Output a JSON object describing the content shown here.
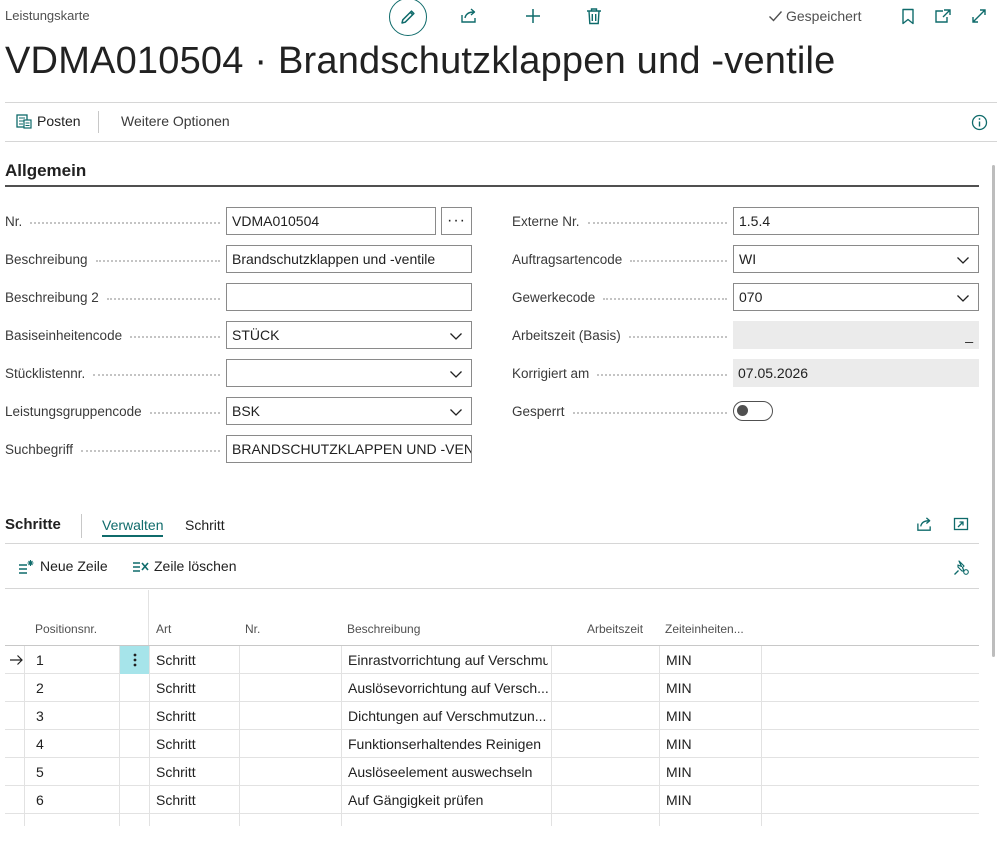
{
  "header": {
    "caption": "Leistungskarte",
    "saved_label": "Gespeichert",
    "title": "VDMA010504 · Brandschutzklappen und -ventile"
  },
  "actions": {
    "posten": "Posten",
    "more": "Weitere Optionen"
  },
  "general": {
    "section_title": "Allgemein",
    "left": [
      {
        "label": "Nr.",
        "value": "VDMA010504",
        "type": "lookup"
      },
      {
        "label": "Beschreibung",
        "value": "Brandschutzklappen und -ventile",
        "type": "text"
      },
      {
        "label": "Beschreibung 2",
        "value": "",
        "type": "text"
      },
      {
        "label": "Basiseinheitencode",
        "value": "STÜCK",
        "type": "select"
      },
      {
        "label": "Stücklistennr.",
        "value": "",
        "type": "select"
      },
      {
        "label": "Leistungsgruppencode",
        "value": "BSK",
        "type": "select"
      },
      {
        "label": "Suchbegriff",
        "value": "BRANDSCHUTZKLAPPEN UND -VENTI",
        "type": "text"
      }
    ],
    "right": [
      {
        "label": "Externe Nr.",
        "value": "1.5.4",
        "type": "text"
      },
      {
        "label": "Auftragsartencode",
        "value": "WI",
        "type": "select"
      },
      {
        "label": "Gewerkecode",
        "value": "070",
        "type": "select"
      },
      {
        "label": "Arbeitszeit (Basis)",
        "value": "_",
        "type": "readonly"
      },
      {
        "label": "Korrigiert am",
        "value": "07.05.2026",
        "type": "readonly"
      },
      {
        "label": "Gesperrt",
        "value": "",
        "type": "toggle",
        "on": false
      }
    ]
  },
  "steps": {
    "title": "Schritte",
    "tabs": [
      "Verwalten",
      "Schritt"
    ],
    "new_line": "Neue Zeile",
    "delete_line": "Zeile löschen",
    "columns": [
      "Positionsnr.",
      "Art",
      "Nr.",
      "Beschreibung",
      "Arbeitszeit",
      "Zeiteinheiten..."
    ],
    "rows": [
      {
        "pos": "1",
        "art": "Schritt",
        "nr": "",
        "beschreibung": "Einrastvorrichtung auf Verschmut",
        "arbeitszeit": "",
        "einheit": "MIN",
        "selected": true
      },
      {
        "pos": "2",
        "art": "Schritt",
        "nr": "",
        "beschreibung": "Auslösevorrichtung auf Versch...",
        "arbeitszeit": "",
        "einheit": "MIN"
      },
      {
        "pos": "3",
        "art": "Schritt",
        "nr": "",
        "beschreibung": "Dichtungen auf Verschmutzun...",
        "arbeitszeit": "",
        "einheit": "MIN"
      },
      {
        "pos": "4",
        "art": "Schritt",
        "nr": "",
        "beschreibung": "Funktionserhaltendes Reinigen",
        "arbeitszeit": "",
        "einheit": "MIN"
      },
      {
        "pos": "5",
        "art": "Schritt",
        "nr": "",
        "beschreibung": "Auslöseelement auswechseln",
        "arbeitszeit": "",
        "einheit": "MIN"
      },
      {
        "pos": "6",
        "art": "Schritt",
        "nr": "",
        "beschreibung": "Auf Gängigkeit prüfen",
        "arbeitszeit": "",
        "einheit": "MIN"
      }
    ]
  },
  "colors": {
    "accent": "#0f6b6b",
    "selected_cell": "#a6e4ea"
  }
}
